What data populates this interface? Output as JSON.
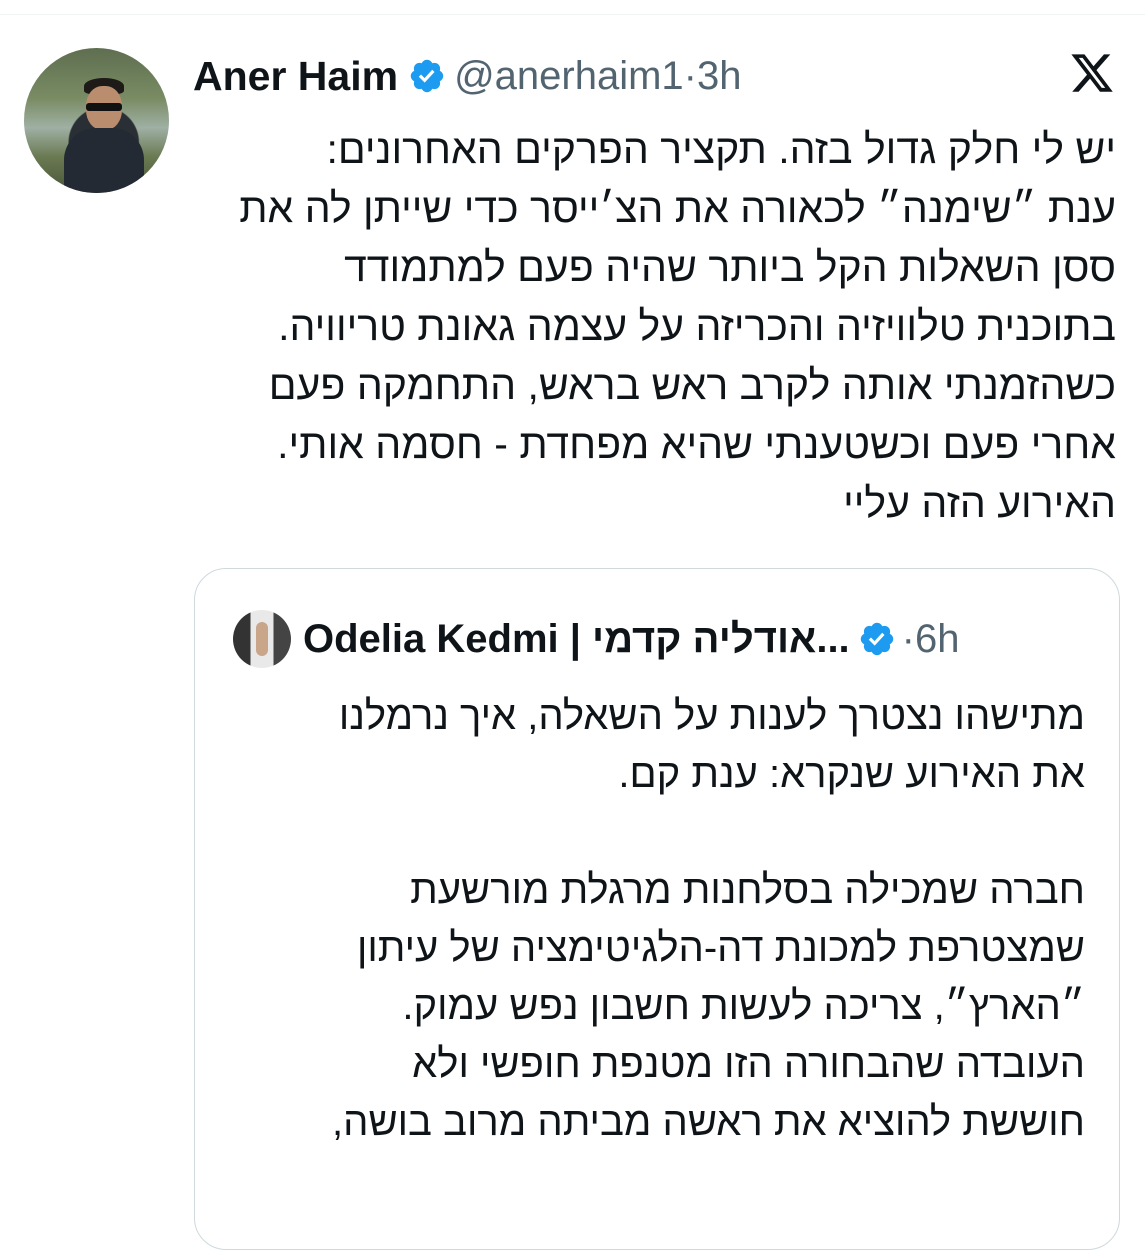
{
  "tweet": {
    "author_name": "Aner Haim",
    "handle": "@anerhaim1",
    "separator": "·",
    "time": "3h",
    "lines": [
      "יש לי חלק גדול בזה. תקציר הפרקים האחרונים:",
      "ענת ״שימנה״ לכאורה את הצ׳ייסר כדי שייתן לה את",
      "ססן השאלות הקל ביותר שהיה פעם למתמודד",
      "בתוכנית טלוויזיה והכריזה על עצמה גאונת טריוויה.",
      "כשהזמנתי אותה לקרב ראש בראש, התחמקה פעם",
      "אחרי פעם וכשטענתי שהיא מפחדת - חסמה אותי.",
      "האירוע הזה עליי"
    ]
  },
  "quote": {
    "author_name": "Odelia Kedmi | אודליה קדמי...",
    "separator": "·",
    "time": "6h",
    "lines": [
      "מתישהו נצטרך לענות על השאלה, איך נרמלנו",
      "את האירוע שנקרא: ענת קם.",
      "",
      "חברה שמכילה בסלחנות מרגלת מורשעת",
      "שמצטרפת למכונת דה-הלגיטימציה של עיתון",
      "״הארץ״, צריכה לעשות חשבון נפש עמוק.",
      "העובדה שהבחורה הזו מטנפת חופשי ולא",
      "חוששת להוציא את ראשה מביתה מרוב בושה,"
    ]
  },
  "colors": {
    "text": "#0f1419",
    "secondary": "#536471",
    "verified_blue": "#1d9bf0",
    "border": "#cfd9de"
  },
  "icons": {
    "verified": "verified-badge-icon",
    "x_logo": "x-logo-icon"
  }
}
